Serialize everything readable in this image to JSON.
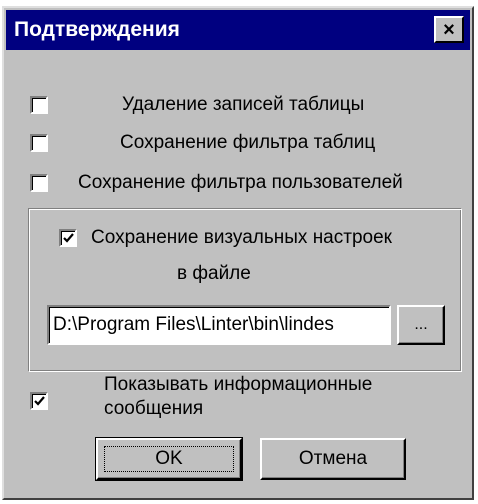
{
  "window": {
    "title": "Подтверждения",
    "close_symbol": "×",
    "close_icon": "close-icon"
  },
  "options": {
    "delete_records": {
      "label": "Удаление записей таблицы",
      "checked": false
    },
    "save_table_filter": {
      "label": "Сохранение фильтра таблиц",
      "checked": false
    },
    "save_user_filter": {
      "label": "Сохранение фильтра пользователей",
      "checked": false
    }
  },
  "visual_settings": {
    "label_line1": "Сохранение визуальных настроек",
    "label_line2": "в файле",
    "checked": true,
    "path_value": "D:\\Program Files\\Linter\\bin\\lindes",
    "browse_label": "..."
  },
  "info_messages": {
    "label_line1": "Показывать информационные",
    "label_line2": "сообщения",
    "checked": true
  },
  "buttons": {
    "ok": "OK",
    "cancel": "Отмена"
  },
  "colors": {
    "titlebar": "#000080",
    "face": "#c0c0c0"
  }
}
